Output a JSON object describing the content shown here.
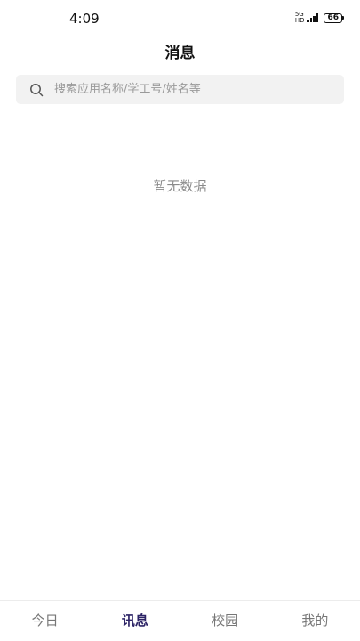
{
  "status_bar": {
    "time": "4:09",
    "network_top": "5G",
    "network_bottom": "HD",
    "battery": "66"
  },
  "header": {
    "title": "消息"
  },
  "search": {
    "placeholder": "搜索应用名称/学工号/姓名等",
    "value": ""
  },
  "main": {
    "empty_text": "暂无数据"
  },
  "tabs": [
    {
      "label": "今日",
      "active": false
    },
    {
      "label": "讯息",
      "active": true
    },
    {
      "label": "校园",
      "active": false
    },
    {
      "label": "我的",
      "active": false
    }
  ],
  "colors": {
    "active_tab": "#2d2466",
    "inactive_tab": "#777777",
    "search_bg": "#f2f2f2"
  }
}
